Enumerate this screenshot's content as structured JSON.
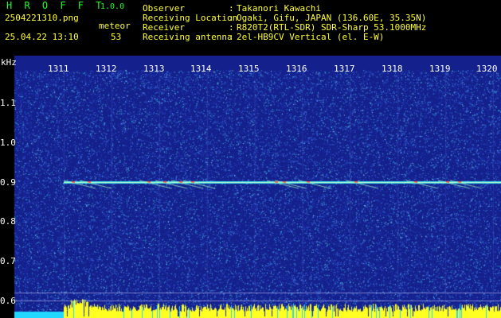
{
  "header": {
    "app_title": "H R O F F T",
    "app_version": "1.0.0",
    "file_name": "2504221310.png",
    "mode_label": "meteor",
    "date_time": "25.04.22 13:10",
    "count": "53",
    "info": [
      {
        "label": "Observer",
        "value": "Takanori Kawachi"
      },
      {
        "label": "Receiving Location",
        "value": "Ogaki, Gifu, JAPAN (136.60E, 35.35N)"
      },
      {
        "label": "Receiver",
        "value": "R820T2(RTL-SDR) SDR-Sharp 53.1000MHz"
      },
      {
        "label": "Receiving antenna",
        "value": "2el-HB9CV Vertical (el. E-W)"
      }
    ]
  },
  "spectrogram": {
    "y_unit": "kHz",
    "y_ticks": [
      "1.1",
      "1.0",
      "0.9",
      "0.8",
      "0.7",
      "0.6"
    ],
    "x_ticks": [
      "1311",
      "1312",
      "1313",
      "1314",
      "1315",
      "1316",
      "1317",
      "1318",
      "1319",
      "1320"
    ],
    "colors": {
      "background": "#14208c",
      "noise_light": "#4a8cff",
      "noise_cyan": "#3ad6e8",
      "trace": "#b8ffcc",
      "trace_hot": "#ff4a3a",
      "strip": "#ffff22",
      "strip_cyan": "#22d8ff"
    }
  }
}
